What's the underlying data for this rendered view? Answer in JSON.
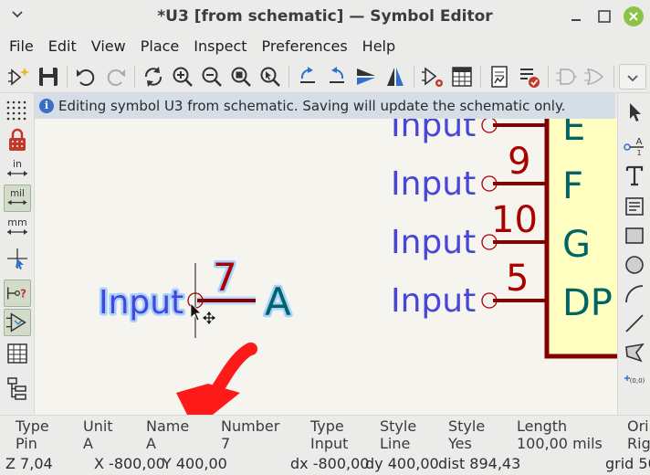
{
  "window": {
    "title": "*U3 [from schematic] — Symbol Editor"
  },
  "menu": [
    "File",
    "Edit",
    "View",
    "Place",
    "Inspect",
    "Preferences",
    "Help"
  ],
  "infobar": {
    "icon": "info-icon",
    "text": "Editing symbol U3 from schematic.  Saving will update the schematic only."
  },
  "left_toolbar": {
    "unit_in": "in",
    "unit_mil": "mil",
    "unit_mm": "mm"
  },
  "canvas": {
    "selected_pin": {
      "type_label": "Input",
      "number": "7",
      "name": "A"
    },
    "right_pins": [
      {
        "type_label": "Input",
        "number": "",
        "name": "E"
      },
      {
        "type_label": "Input",
        "number": "9",
        "name": "F"
      },
      {
        "type_label": "Input",
        "number": "10",
        "name": "G"
      },
      {
        "type_label": "Input",
        "number": "5",
        "name": "DP"
      }
    ],
    "colors": {
      "background": "#f5f4ef",
      "pin_line": "#840000",
      "pin_number": "#a90000",
      "pin_name": "#006464",
      "pin_type": "#4646d8",
      "body_fill": "#ffffc2",
      "body_outline": "#840000"
    }
  },
  "properties": {
    "columns": [
      {
        "header": "Type",
        "value": "Pin"
      },
      {
        "header": "Unit",
        "value": "A"
      },
      {
        "header": "Name",
        "value": "A"
      },
      {
        "header": "Number",
        "value": "7"
      },
      {
        "header": "Type",
        "value": "Input"
      },
      {
        "header": "Style",
        "value": "Line"
      },
      {
        "header": "Style",
        "value": "Yes"
      },
      {
        "header": "Length",
        "value": "100,00 mils"
      },
      {
        "header": "Ori",
        "value": "Rig"
      }
    ]
  },
  "status": {
    "zoom": "Z 7,04",
    "x": "X -800,00",
    "y": "Y 400,00",
    "dx": "dx -800,00",
    "dy": "dy 400,00",
    "dist": "dist 894,43",
    "grid": "grid 50"
  },
  "annotation": {
    "color": "#ff1a1a",
    "shape": "red-arrow"
  }
}
